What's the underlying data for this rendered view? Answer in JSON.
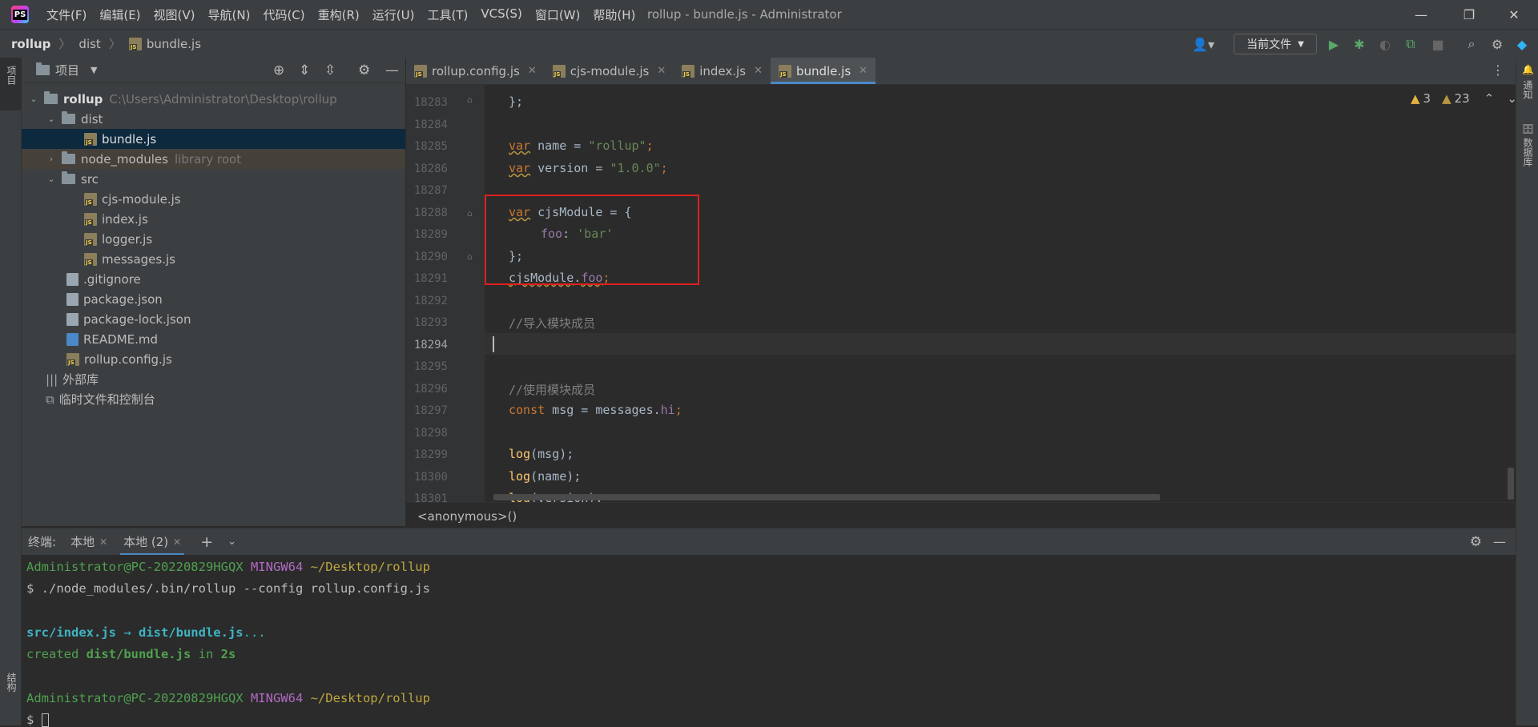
{
  "app": {
    "logo_text": "PS",
    "menu": [
      "文件(F)",
      "编辑(E)",
      "视图(V)",
      "导航(N)",
      "代码(C)",
      "重构(R)",
      "运行(U)",
      "工具(T)",
      "VCS(S)",
      "窗口(W)",
      "帮助(H)"
    ],
    "window_title": "rollup - bundle.js - Administrator"
  },
  "breadcrumb": {
    "items": [
      "rollup",
      "dist",
      "bundle.js"
    ]
  },
  "toolbar": {
    "run_config": "当前文件"
  },
  "left_stripe": {
    "project_label": "项目",
    "structure_label": "结构"
  },
  "right_stripe": {
    "notifications_label": "通知",
    "database_label": "数据库"
  },
  "project": {
    "title": "项目",
    "tree": [
      {
        "label": "rollup",
        "extra": "C:\\Users\\Administrator\\Desktop\\rollup"
      },
      {
        "label": "dist"
      },
      {
        "label": "bundle.js"
      },
      {
        "label": "node_modules",
        "extra": "library root"
      },
      {
        "label": "src"
      },
      {
        "label": "cjs-module.js"
      },
      {
        "label": "index.js"
      },
      {
        "label": "logger.js"
      },
      {
        "label": "messages.js"
      },
      {
        "label": ".gitignore"
      },
      {
        "label": "package.json"
      },
      {
        "label": "package-lock.json"
      },
      {
        "label": "README.md"
      },
      {
        "label": "rollup.config.js"
      },
      {
        "label": "外部库"
      },
      {
        "label": "临时文件和控制台"
      }
    ]
  },
  "editor": {
    "tabs": [
      "rollup.config.js",
      "cjs-module.js",
      "index.js",
      "bundle.js"
    ],
    "active_tab": "bundle.js",
    "warnings": "3",
    "weak_warnings": "23",
    "line_numbers": [
      "18283",
      "18284",
      "18285",
      "18286",
      "18287",
      "18288",
      "18289",
      "18290",
      "18291",
      "18292",
      "18293",
      "18294",
      "18295",
      "18296",
      "18297",
      "18298",
      "18299",
      "18300",
      "18301"
    ],
    "current_line": "18294",
    "code": {
      "l18283": "};",
      "l18285_kw": "var",
      "l18285_rest": " name = ",
      "l18285_str": "\"rollup\"",
      "l18285_end": ";",
      "l18286_kw": "var",
      "l18286_rest": " version = ",
      "l18286_str": "\"1.0.0\"",
      "l18286_end": ";",
      "l18288_kw": "var",
      "l18288_rest": " cjsModule = {",
      "l18289_prop": "foo",
      "l18289_mid": ": ",
      "l18289_str": "'bar'",
      "l18290": "};",
      "l18291_obj": "cjsModule",
      "l18291_dot": ".",
      "l18291_prop": "foo",
      "l18291_end": ";",
      "l18293": "//导入模块成员",
      "l18296": "//使用模块成员",
      "l18297_kw": "const",
      "l18297_rest": " msg = messages.",
      "l18297_prop": "hi",
      "l18297_end": ";",
      "l18299_fn": "log",
      "l18299_rest": "(msg);",
      "l18300_fn": "log",
      "l18300_rest": "(name);",
      "l18301_fn": "log",
      "l18301_rest": "(version);"
    },
    "context": "<anonymous>()"
  },
  "terminal": {
    "label": "终端:",
    "tabs": [
      "本地",
      "本地 (2)"
    ],
    "lines": {
      "prompt1_user": "Administrator@PC-20220829HGQX",
      "prompt1_env": "MINGW64",
      "prompt1_path": "~/Desktop/rollup",
      "cmd1": "$ ./node_modules/.bin/rollup --config rollup.config.js",
      "out1_a": "src/index.js",
      "out1_arrow": " → ",
      "out1_b": "dist/bundle.js",
      "out1_c": "...",
      "out2_a": "created ",
      "out2_b": "dist/bundle.js",
      "out2_c": " in ",
      "out2_d": "2s",
      "prompt2_user": "Administrator@PC-20220829HGQX",
      "prompt2_env": "MINGW64",
      "prompt2_path": "~/Desktop/rollup",
      "prompt_sign": "$ "
    }
  },
  "colors": {
    "accent": "#4a88c7",
    "highlight_box": "#e0201e"
  }
}
